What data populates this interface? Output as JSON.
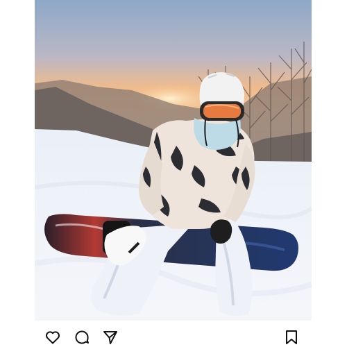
{
  "post": {
    "image": {
      "subject": "snowboarder-kneeling-on-snow",
      "palette": {
        "sky_top": "#8fa7c7",
        "sky_glow": "#f2b27c",
        "horizon": "#f6c18a",
        "snow": "#f4f6fb",
        "snow_shadow": "#d9dfeb",
        "trees": "#7c6c62",
        "helmet": "#f1f1f1",
        "goggle_lens": "#e2743d",
        "jacket_light": "#efe6df",
        "jacket_dark": "#2b2b31",
        "pants": "#eef1f7",
        "board_dark": "#1e2a45",
        "board_red": "#b93a31",
        "gloves": "#f7f7f7"
      }
    },
    "actions": {
      "like_icon": "heart-outline",
      "comment_icon": "speech-bubble-outline",
      "share_icon": "paper-plane-outline",
      "save_icon": "bookmark-outline"
    }
  }
}
